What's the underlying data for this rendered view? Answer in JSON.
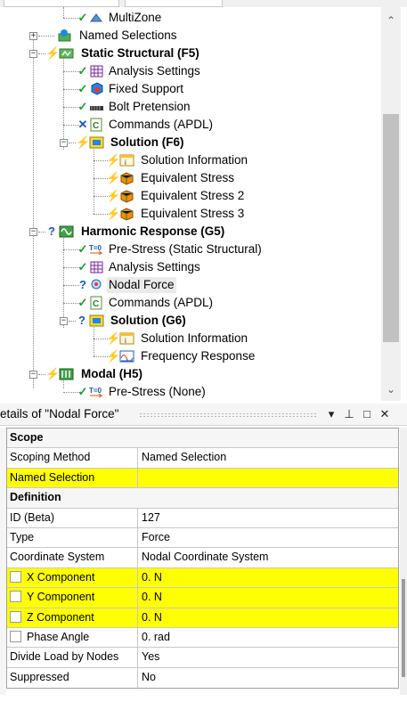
{
  "tree": {
    "items": [
      {
        "label": "MultiZone",
        "bold": false,
        "icon": "multizone-mesh-icon",
        "state": "check"
      },
      {
        "label": "Named Selections",
        "bold": false,
        "icon": "named-selections-icon",
        "state": ""
      },
      {
        "label": "Static Structural (F5)",
        "bold": true,
        "icon": "static-structural-icon",
        "state": "bolt"
      },
      {
        "label": "Analysis Settings",
        "bold": false,
        "icon": "analysis-settings-icon",
        "state": "check"
      },
      {
        "label": "Fixed Support",
        "bold": false,
        "icon": "fixed-support-icon",
        "state": "check"
      },
      {
        "label": "Bolt Pretension",
        "bold": false,
        "icon": "bolt-pretension-icon",
        "state": "check"
      },
      {
        "label": "Commands (APDL)",
        "bold": false,
        "icon": "commands-apdl-icon",
        "state": "x"
      },
      {
        "label": "Solution (F6)",
        "bold": true,
        "icon": "solution-icon",
        "state": "bolt"
      },
      {
        "label": "Solution Information",
        "bold": false,
        "icon": "solution-information-icon",
        "state": "bolt"
      },
      {
        "label": "Equivalent Stress",
        "bold": false,
        "icon": "equivalent-stress-icon",
        "state": "bolt"
      },
      {
        "label": "Equivalent Stress 2",
        "bold": false,
        "icon": "equivalent-stress-icon",
        "state": "bolt"
      },
      {
        "label": "Equivalent Stress 3",
        "bold": false,
        "icon": "equivalent-stress-icon",
        "state": "bolt"
      },
      {
        "label": "Harmonic Response (G5)",
        "bold": true,
        "icon": "harmonic-response-icon",
        "state": "q"
      },
      {
        "label": "Pre-Stress (Static Structural)",
        "bold": false,
        "icon": "pre-stress-icon",
        "state": "check"
      },
      {
        "label": "Analysis Settings",
        "bold": false,
        "icon": "analysis-settings-icon",
        "state": "check"
      },
      {
        "label": "Nodal Force",
        "bold": false,
        "icon": "nodal-force-icon",
        "state": "q",
        "selected": true
      },
      {
        "label": "Commands (APDL)",
        "bold": false,
        "icon": "commands-apdl-icon",
        "state": "check"
      },
      {
        "label": "Solution (G6)",
        "bold": true,
        "icon": "solution-icon",
        "state": "q"
      },
      {
        "label": "Solution Information",
        "bold": false,
        "icon": "solution-information-icon",
        "state": "bolt"
      },
      {
        "label": "Frequency Response",
        "bold": false,
        "icon": "frequency-response-icon",
        "state": "bolt"
      },
      {
        "label": "Modal (H5)",
        "bold": true,
        "icon": "modal-icon",
        "state": "bolt"
      },
      {
        "label": "Pre-Stress (None)",
        "bold": false,
        "icon": "pre-stress-icon",
        "state": "check"
      }
    ]
  },
  "details": {
    "title": "etails of \"Nodal Force\"",
    "buttons": {
      "dropdown": "▾",
      "pin": "⊥",
      "maximize": "□",
      "close": "✕"
    },
    "rows": [
      {
        "type": "cat",
        "label": "Scope"
      },
      {
        "type": "prop",
        "label": "Scoping Method",
        "value": "Named Selection"
      },
      {
        "type": "prop",
        "label": "Named Selection",
        "value": "",
        "yellow": true
      },
      {
        "type": "cat",
        "label": "Definition"
      },
      {
        "type": "prop",
        "label": "ID (Beta)",
        "value": "127"
      },
      {
        "type": "prop",
        "label": "Type",
        "value": "Force"
      },
      {
        "type": "prop",
        "label": "Coordinate System",
        "value": "Nodal Coordinate System"
      },
      {
        "type": "prop",
        "label": "X Component",
        "value": "0. N",
        "yellow": true,
        "checkbox": true
      },
      {
        "type": "prop",
        "label": "Y Component",
        "value": "0. N",
        "yellow": true,
        "checkbox": true
      },
      {
        "type": "prop",
        "label": "Z Component",
        "value": "0. N",
        "yellow": true,
        "checkbox": true
      },
      {
        "type": "prop",
        "label": "Phase Angle",
        "value": "0. rad",
        "checkbox": true
      },
      {
        "type": "prop",
        "label": "Divide Load by Nodes",
        "value": "Yes"
      },
      {
        "type": "prop",
        "label": "Suppressed",
        "value": "No"
      }
    ]
  },
  "colors": {
    "required": "#ffff00",
    "selection": "#ebebeb"
  }
}
